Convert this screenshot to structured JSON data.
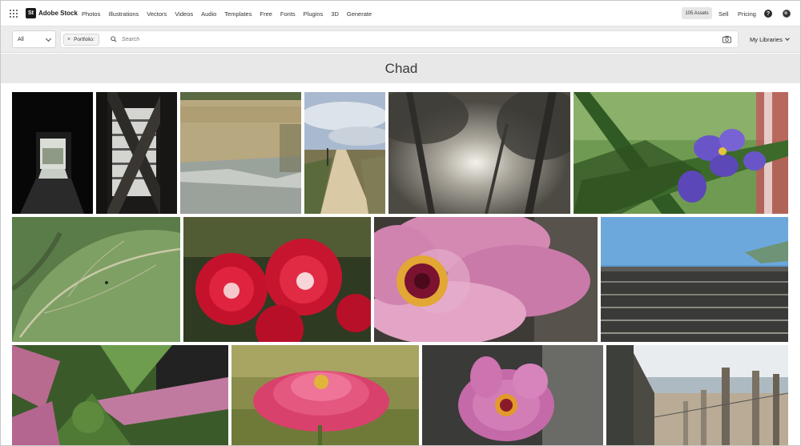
{
  "brand": {
    "mark": "St",
    "name": "Adobe Stock"
  },
  "nav": {
    "items": [
      "Photos",
      "Illustrations",
      "Vectors",
      "Videos",
      "Audio",
      "Templates",
      "Free",
      "Fonts",
      "Plugins",
      "3D",
      "Generate"
    ]
  },
  "header_right": {
    "assets": "105 Assets",
    "sell": "Sell",
    "pricing": "Pricing",
    "help": "?"
  },
  "search": {
    "type_value": "All",
    "chip_label": "Portfolio:",
    "chip_close": "×",
    "placeholder": "Search",
    "my_libraries": "My Libraries"
  },
  "page": {
    "title": "Chad"
  },
  "colors": {
    "accent": "#1a1a1a",
    "band": "#e8e8e8",
    "search_bar": "#ececec"
  },
  "gallery": {
    "items": [
      {
        "icon": "covered-bridge-tunnel-photo"
      },
      {
        "icon": "bridge-timber-truss-photo"
      },
      {
        "icon": "marsh-reeds-water-photo"
      },
      {
        "icon": "sandy-path-dunes-photo"
      },
      {
        "icon": "trees-sun-canopy-photo"
      },
      {
        "icon": "purple-spiderwort-flower-photo"
      },
      {
        "icon": "green-leaf-insect-photo"
      },
      {
        "icon": "red-roses-photo"
      },
      {
        "icon": "pink-dahlia-closeup-photo"
      },
      {
        "icon": "roof-shingles-sky-photo"
      },
      {
        "icon": "green-pink-plant-photo"
      },
      {
        "icon": "pink-zinnia-flower-photo"
      },
      {
        "icon": "pink-dahlia-dark-photo"
      },
      {
        "icon": "beach-fence-posts-photo"
      }
    ]
  }
}
